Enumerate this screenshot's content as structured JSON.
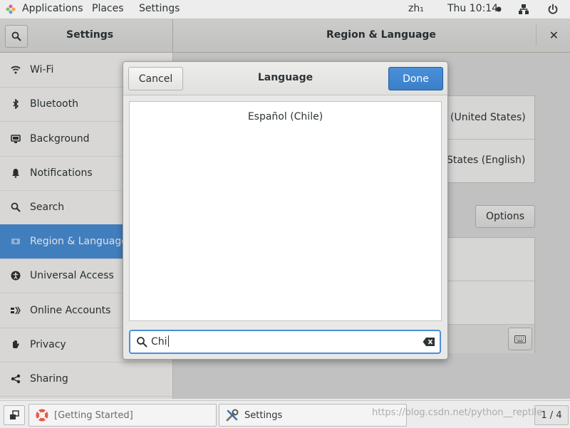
{
  "topbar": {
    "applications": "Applications",
    "places": "Places",
    "settings": "Settings",
    "input_method": "zh₁",
    "clock": "Thu 10:14",
    "icons": [
      "apps-logo-icon",
      "recording-dot-icon",
      "network-icon",
      "power-icon"
    ]
  },
  "window": {
    "left_title": "Settings",
    "right_title": "Region & Language"
  },
  "sidebar": {
    "items": [
      {
        "label": "Wi-Fi",
        "icon": "wifi-icon"
      },
      {
        "label": "Bluetooth",
        "icon": "bluetooth-icon"
      },
      {
        "label": "Background",
        "icon": "background-icon"
      },
      {
        "label": "Notifications",
        "icon": "bell-icon"
      },
      {
        "label": "Search",
        "icon": "search-icon"
      },
      {
        "label": "Region & Language",
        "icon": "region-icon",
        "active": true
      },
      {
        "label": "Universal Access",
        "icon": "accessibility-icon"
      },
      {
        "label": "Online Accounts",
        "icon": "online-accounts-icon"
      },
      {
        "label": "Privacy",
        "icon": "hand-icon"
      },
      {
        "label": "Sharing",
        "icon": "share-icon"
      }
    ]
  },
  "main": {
    "row1_partial": "(United States)",
    "row2_partial": "States (English)",
    "options_label": "Options"
  },
  "dialog": {
    "title": "Language",
    "cancel_label": "Cancel",
    "done_label": "Done",
    "results": [
      "Español (Chile)"
    ],
    "search_value": "Chi"
  },
  "taskbar": {
    "items": [
      {
        "label": "[Getting Started]",
        "icon": "help-lifebuoy-icon"
      },
      {
        "label": "Settings",
        "icon": "settings-tools-icon"
      }
    ],
    "workspace": "1 / 4"
  },
  "watermark": "https://blog.csdn.net/python__reptile",
  "colors": {
    "accent": "#4a90d9",
    "window_bg": "#f6f5f4",
    "text": "#2e3436"
  }
}
